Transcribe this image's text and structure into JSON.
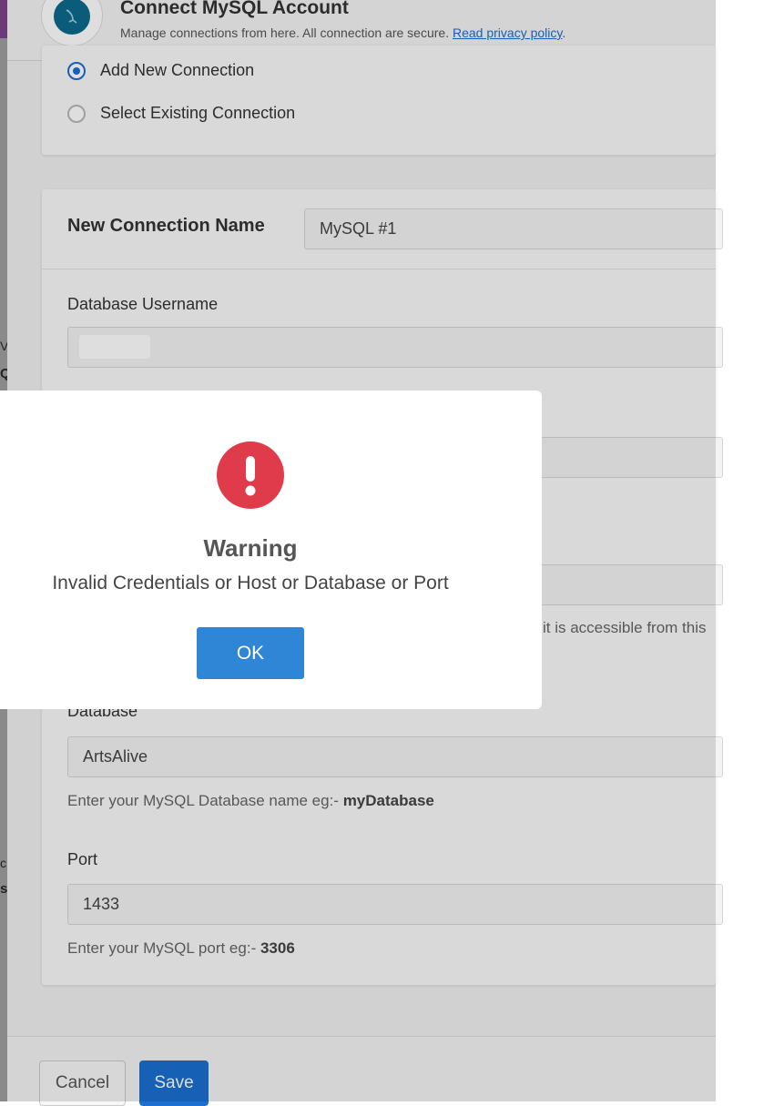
{
  "background": {
    "fragments": [
      "V",
      "Q",
      "c",
      "s"
    ]
  },
  "header": {
    "title": "Connect MySQL Account",
    "subtitle": "Manage connections from here. All connection are secure.",
    "privacy_link": "Read privacy policy",
    "privacy_suffix": "."
  },
  "connection_choice": {
    "options": [
      {
        "label": "Add New Connection",
        "selected": true
      },
      {
        "label": "Select Existing Connection",
        "selected": false
      }
    ]
  },
  "form": {
    "connection_name_label": "New Connection Name",
    "connection_name_value": "MySQL #1",
    "username_label": "Database Username",
    "host_hint_fragment": "it is accessible from this",
    "database_label": "Database",
    "database_value": "ArtsAlive",
    "database_hint": "Enter your MySQL Database name eg:- ",
    "database_hint_example": "myDatabase",
    "port_label": "Port",
    "port_value": "1433",
    "port_hint": "Enter your MySQL port eg:- ",
    "port_hint_example": "3306"
  },
  "footer": {
    "cancel_label": "Cancel",
    "save_label": "Save"
  },
  "modal": {
    "icon": "exclamation-icon",
    "title": "Warning",
    "message": "Invalid Credentials or Host or Database or Port",
    "ok_label": "OK"
  },
  "colors": {
    "accent": "#1a6fd0",
    "warning": "#e03b4b",
    "ok_button": "#2f86d6"
  }
}
